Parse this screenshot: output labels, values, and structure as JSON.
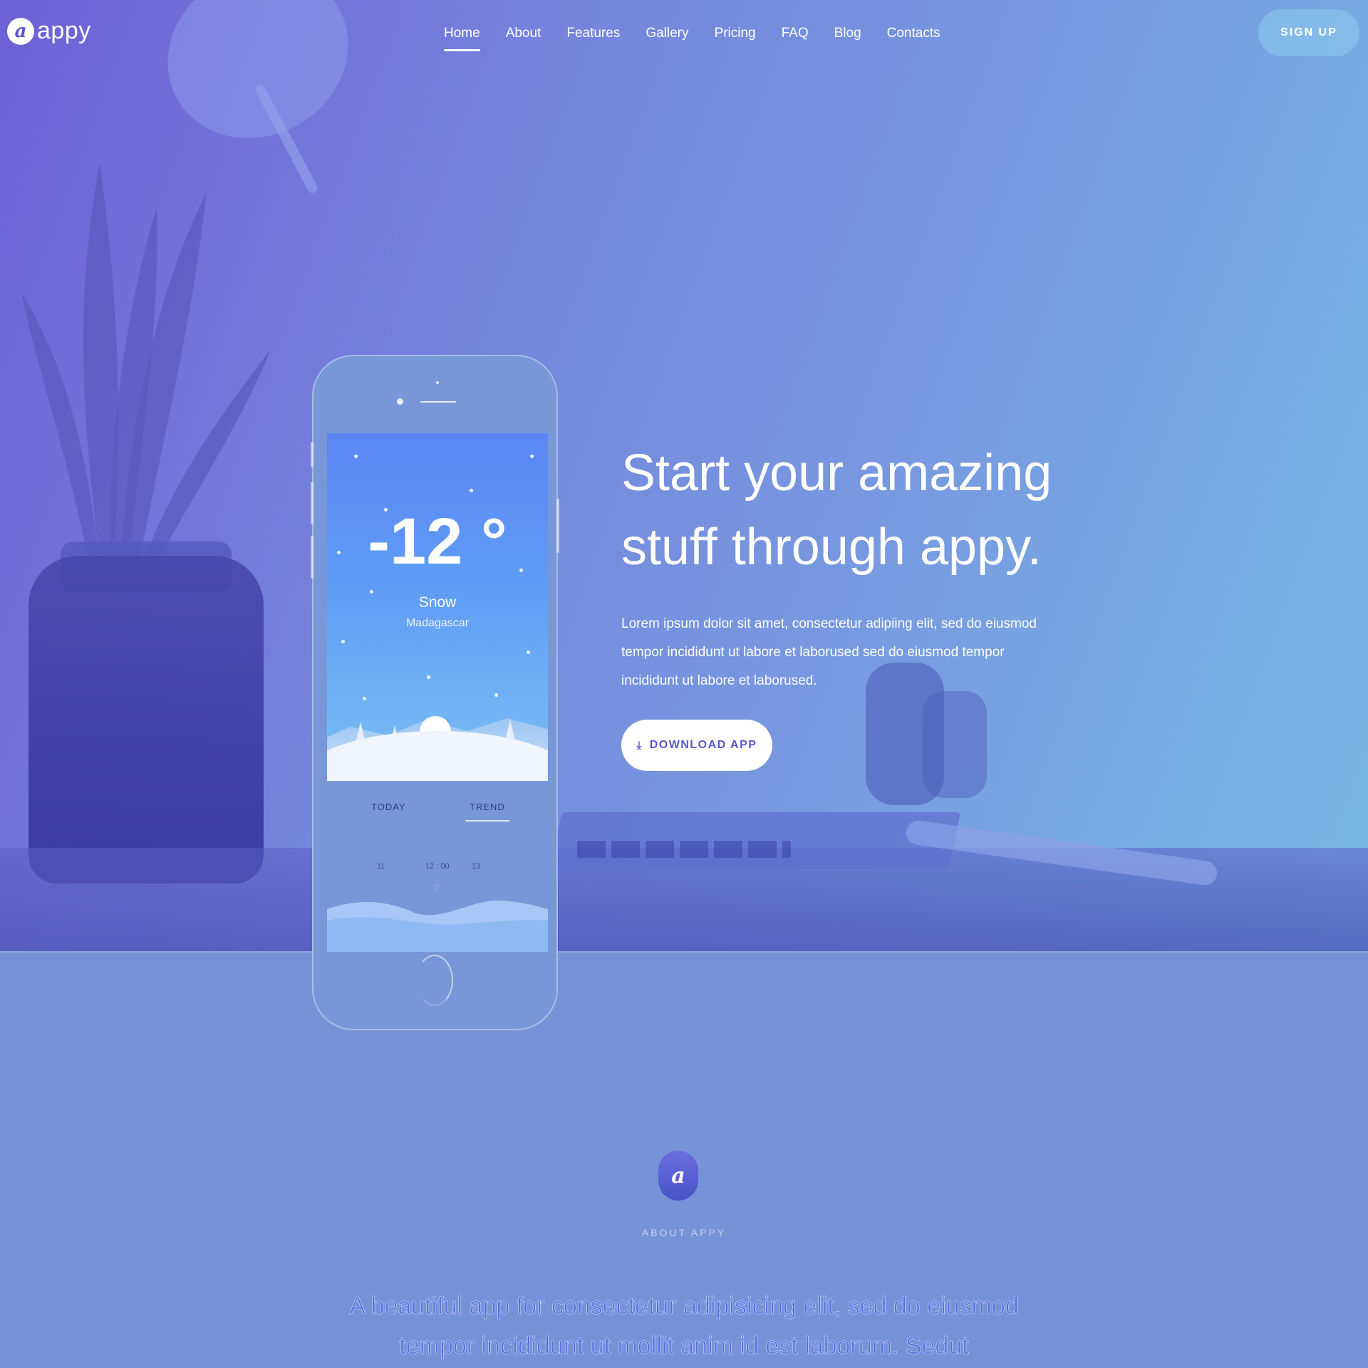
{
  "brand": {
    "logo_letter": "a",
    "name": "appy"
  },
  "nav": {
    "items": [
      "Home",
      "About",
      "Features",
      "Gallery",
      "Pricing",
      "FAQ",
      "Blog",
      "Contacts"
    ],
    "active": "Home",
    "signup_label": "SIGN UP"
  },
  "hero": {
    "headline_line1": "Start your amazing",
    "headline_line2": "stuff through appy.",
    "lead": "Lorem ipsum dolor sit amet, consectetur adipiing elit, sed do eiusmod tempor incididunt ut labore et laborused sed do eiusmod tempor incididunt ut labore et laborused.",
    "download_label": "DOWNLOAD APP",
    "download_icon": "download-icon"
  },
  "phone": {
    "temperature": "-12 °",
    "condition": "Snow",
    "location": "Madagascar",
    "tabs": [
      "TODAY",
      "TREND"
    ],
    "active_tab": "TREND",
    "hours": [
      "11",
      "12 : 00",
      "13"
    ]
  },
  "about": {
    "logo_letter": "a",
    "tag": "ABOUT APPY",
    "text_line1": "A beautiful app for consectetur adipisicing elit, sed do eiusmod",
    "text_line2": "tempor incididunt ut mollit anim id est laborum. Sedut"
  },
  "colors": {
    "gradient_start": "#6e60d6",
    "gradient_end": "#78b9e6",
    "accent": "#5b56c9",
    "section_bg": "#7793d8"
  }
}
